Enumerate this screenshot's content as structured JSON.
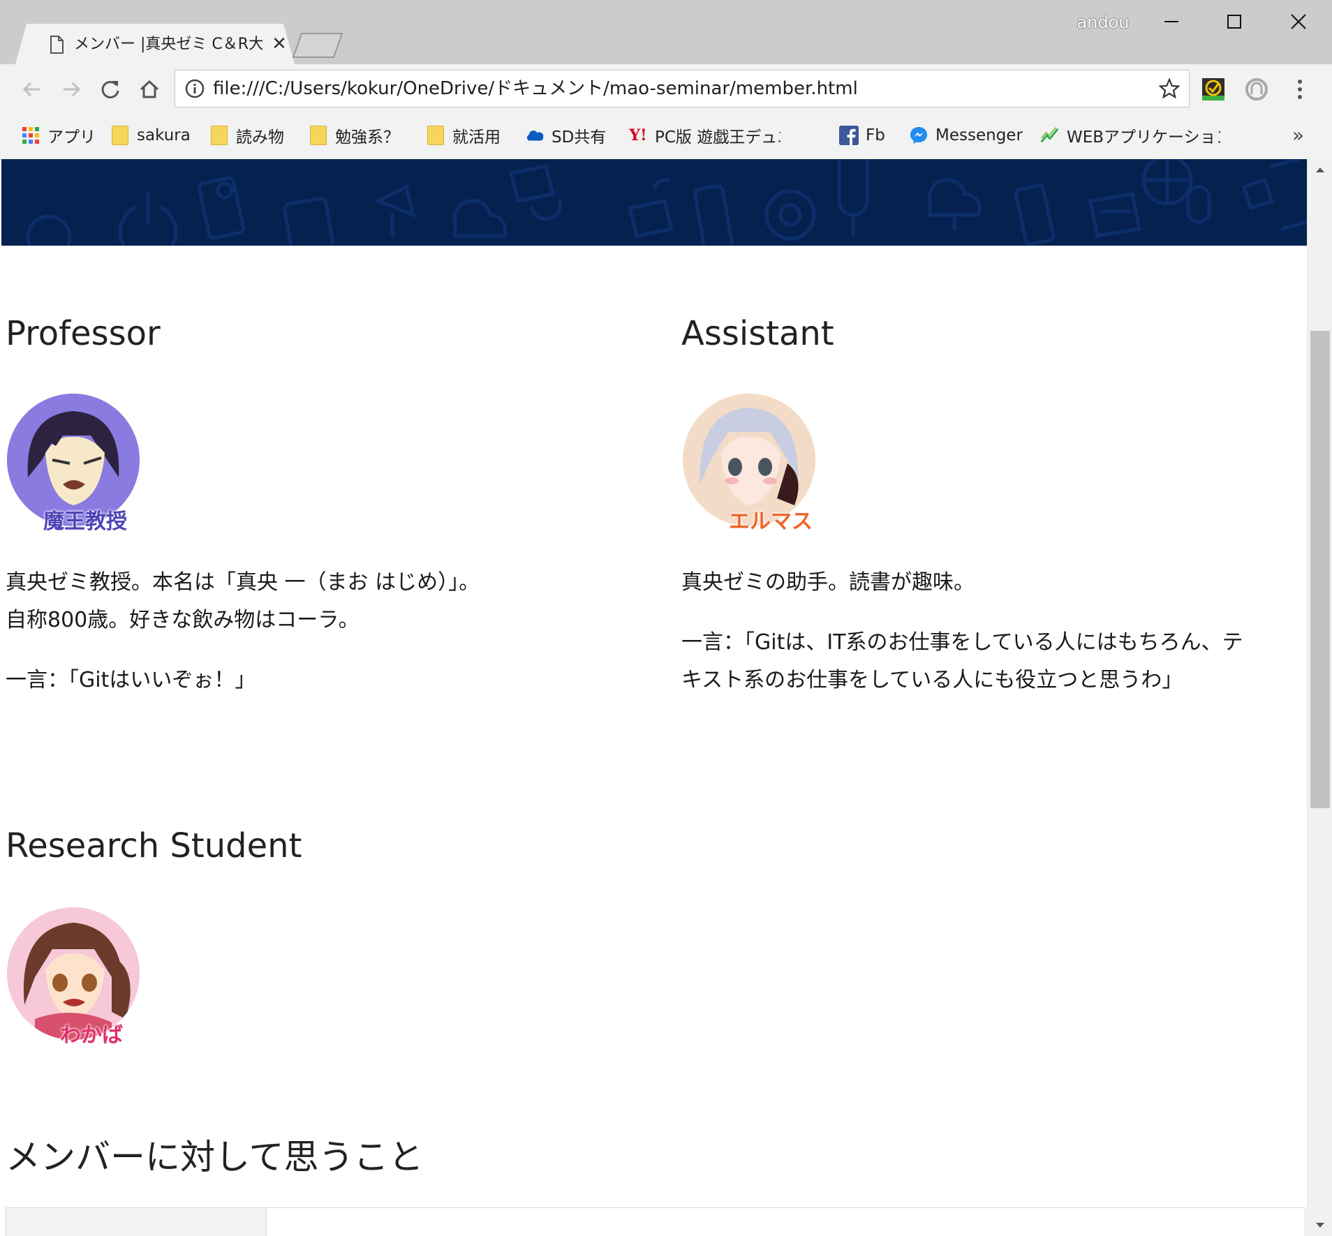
{
  "browser": {
    "tab_title": "メンバー |真央ゼミ C＆R大学",
    "tab_close": "✕",
    "user_name": "andou",
    "url": "file:///C:/Users/kokur/OneDrive/ドキュメント/mao-seminar/member.html",
    "bookmarks": [
      {
        "label": "アプリ",
        "icon": "apps-grid-icon"
      },
      {
        "label": "sakura",
        "icon": "folder-icon"
      },
      {
        "label": "読み物",
        "icon": "folder-icon"
      },
      {
        "label": "勉強系？",
        "icon": "folder-icon"
      },
      {
        "label": "就活用",
        "icon": "folder-icon"
      },
      {
        "label": "SD共有",
        "icon": "onedrive-icon"
      },
      {
        "label": "PC版 遊戯王デュエルリ",
        "icon": "yahoo-icon"
      },
      {
        "label": "Fb",
        "icon": "facebook-icon"
      },
      {
        "label": "Messenger",
        "icon": "messenger-icon"
      },
      {
        "label": "WEBアプリケーションエキ",
        "icon": "chart-icon"
      }
    ],
    "bookmarks_more": "»"
  },
  "page": {
    "professor": {
      "heading": "Professor",
      "avatar_label": "魔王教授",
      "lines": [
        "真央ゼミ教授。本名は「真央 一（まお はじめ）」。",
        "自称800歳。好きな飲み物はコーラ。"
      ],
      "quote": "一言：「Gitはいいぞぉ！」"
    },
    "assistant": {
      "heading": "Assistant",
      "avatar_label": "エルマス",
      "line": "真央ゼミの助手。読書が趣味。",
      "quote_lines": [
        "一言：「Gitは、IT系のお仕事をしている人にはもちろん、テ",
        "キスト系のお仕事をしている人にも役立つと思うわ」"
      ]
    },
    "student": {
      "heading": "Research Student",
      "avatar_label": "わかば"
    },
    "section_title": "メンバーに対して思うこと"
  },
  "colors": {
    "banner": "#05214f",
    "professor_avatar_bg": "#7b6bd6",
    "assistant_avatar_bg": "#f3dcc7",
    "student_avatar_bg": "#f6c8d8"
  }
}
